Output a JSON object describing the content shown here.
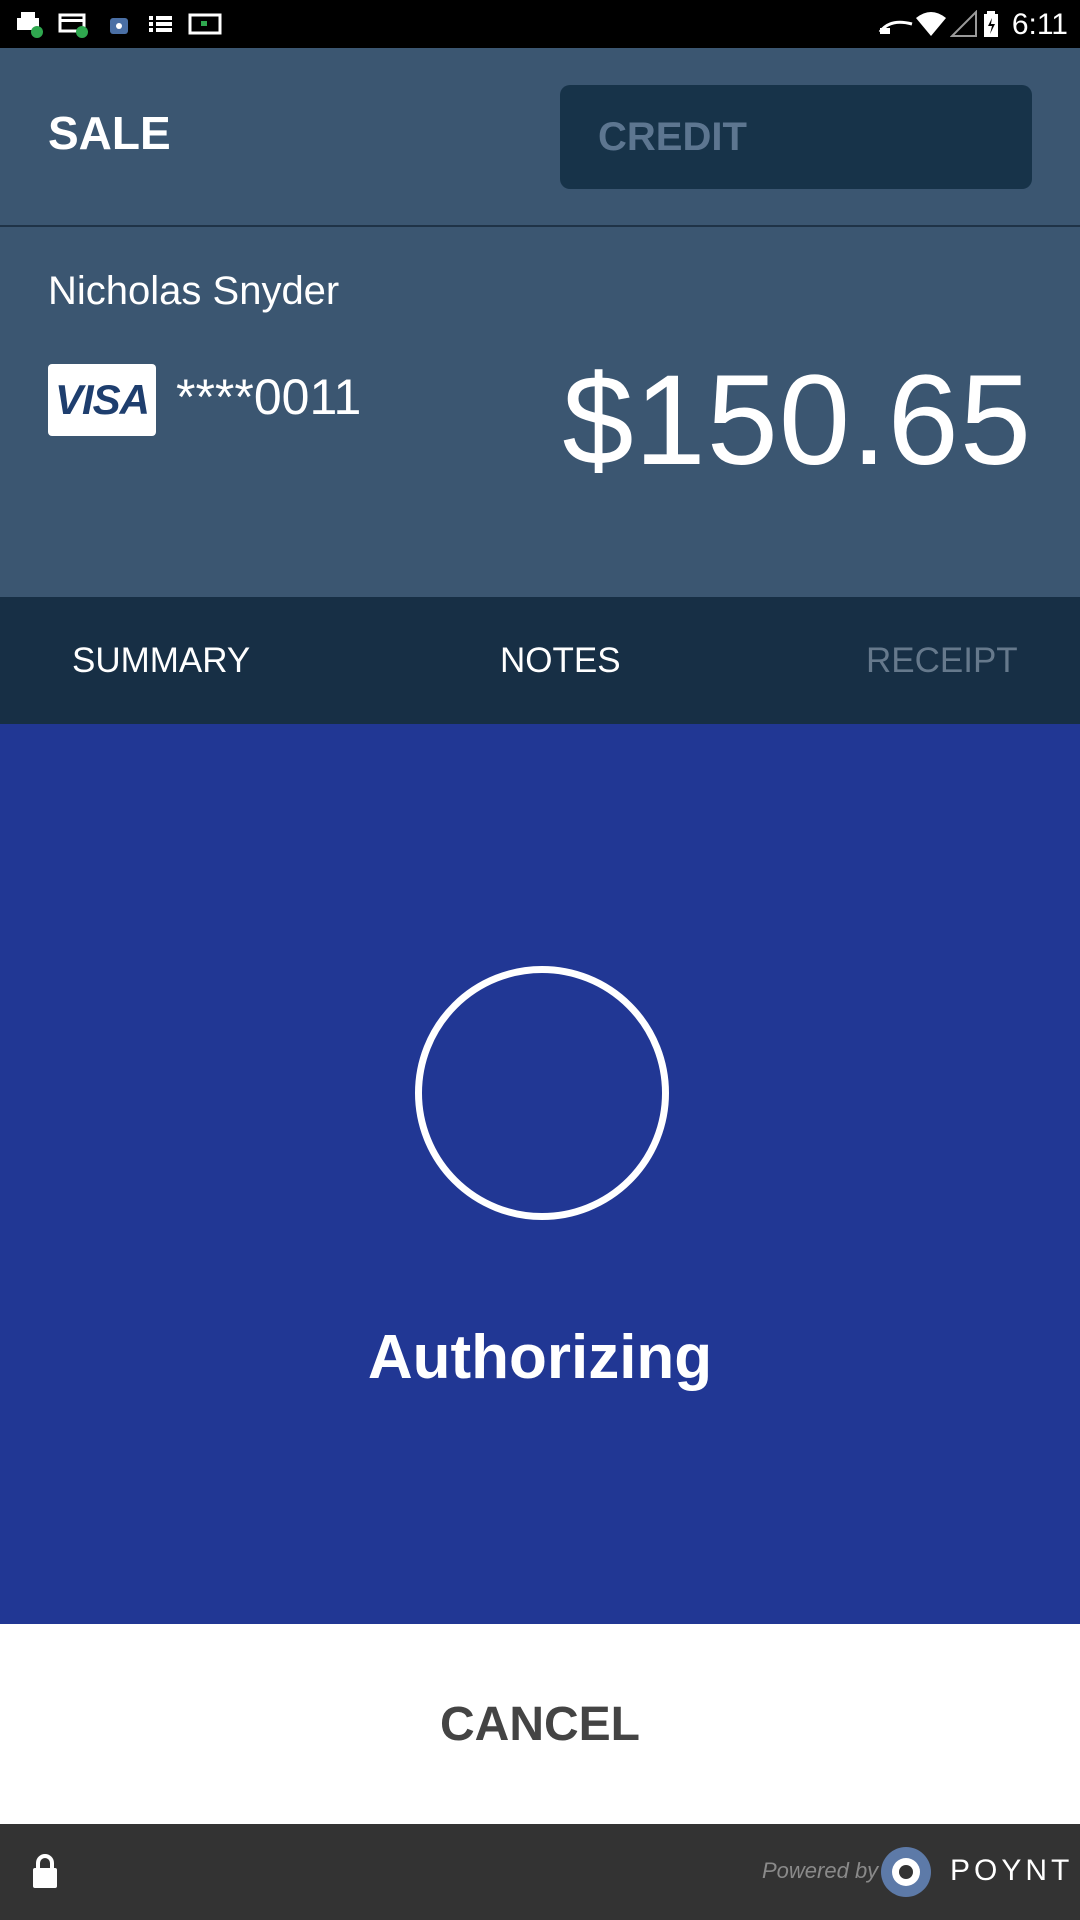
{
  "status_bar": {
    "time": "6:11",
    "icons": [
      "printer-icon",
      "card-icon",
      "android-icon",
      "list-icon",
      "screen-icon",
      "cast-icon",
      "wifi-icon",
      "signal-icon",
      "battery-icon"
    ]
  },
  "header": {
    "title": "SALE",
    "payment_type": "CREDIT"
  },
  "customer": {
    "name": "Nicholas Snyder",
    "card_brand": "VISA",
    "card_number": "****0011",
    "amount": "$150.65"
  },
  "tabs": [
    {
      "label": "SUMMARY",
      "enabled": true
    },
    {
      "label": "NOTES",
      "enabled": true
    },
    {
      "label": "RECEIPT",
      "enabled": false
    }
  ],
  "auth": {
    "status": "Authorizing"
  },
  "actions": {
    "cancel_label": "CANCEL"
  },
  "footer": {
    "powered_by": "Powered by",
    "brand": "POYNT"
  },
  "colors": {
    "header_bg": "#3b5671",
    "tab_bg": "#172f45",
    "auth_bg": "#213794",
    "footer_bg": "#333333"
  }
}
